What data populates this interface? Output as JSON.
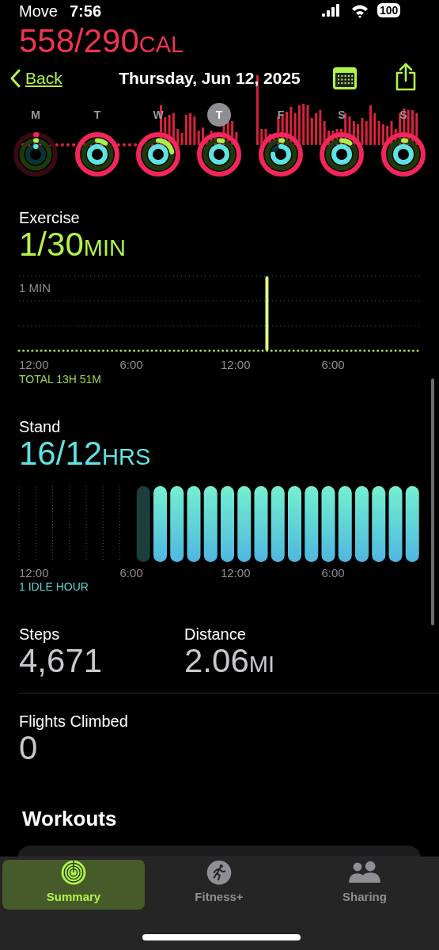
{
  "move": {
    "title": "Move",
    "value": "558/290",
    "unit": "CAL"
  },
  "status_bar": {
    "time": "7:56",
    "battery": "100"
  },
  "nav": {
    "back": "Back",
    "title": "Thursday, Jun 12, 2025"
  },
  "week": [
    {
      "label": "M",
      "selected": false
    },
    {
      "label": "T",
      "selected": false
    },
    {
      "label": "W",
      "selected": false
    },
    {
      "label": "T",
      "selected": true
    },
    {
      "label": "F",
      "selected": false
    },
    {
      "label": "S",
      "selected": false
    },
    {
      "label": "S",
      "selected": false
    }
  ],
  "exercise": {
    "title": "Exercise",
    "value": "1/30",
    "unit": "MIN",
    "y_label": "1 MIN",
    "axis": [
      "12:00",
      "6:00",
      "12:00",
      "6:00"
    ],
    "total": "TOTAL 13H 51M"
  },
  "stand": {
    "title": "Stand",
    "value": "16/12",
    "unit": "HRS",
    "hours": [
      {
        "kind": "empty"
      },
      {
        "kind": "empty"
      },
      {
        "kind": "empty"
      },
      {
        "kind": "empty"
      },
      {
        "kind": "empty"
      },
      {
        "kind": "empty"
      },
      {
        "kind": "empty"
      },
      {
        "kind": "idle"
      },
      {
        "kind": "stood"
      },
      {
        "kind": "stood"
      },
      {
        "kind": "stood"
      },
      {
        "kind": "stood"
      },
      {
        "kind": "stood"
      },
      {
        "kind": "stood"
      },
      {
        "kind": "stood"
      },
      {
        "kind": "stood"
      },
      {
        "kind": "stood"
      },
      {
        "kind": "stood"
      },
      {
        "kind": "stood"
      },
      {
        "kind": "stood"
      },
      {
        "kind": "stood"
      },
      {
        "kind": "stood"
      },
      {
        "kind": "stood"
      },
      {
        "kind": "stood"
      }
    ],
    "axis": [
      "12:00",
      "6:00",
      "12:00",
      "6:00"
    ],
    "summary": "1 IDLE HOUR"
  },
  "stats": [
    {
      "label": "Steps",
      "value": "4,671"
    },
    {
      "label": "Distance",
      "value": "2.06",
      "unit": "MI"
    },
    {
      "label": "Flights Climbed",
      "value": "0"
    }
  ],
  "workouts": {
    "title": "Workouts"
  },
  "tabs": [
    {
      "kind": "summary",
      "label": "Summary",
      "selected": true
    },
    {
      "kind": "fitness",
      "label": "Fitness+",
      "selected": false
    },
    {
      "kind": "sharing",
      "label": "Sharing",
      "selected": false
    }
  ]
}
